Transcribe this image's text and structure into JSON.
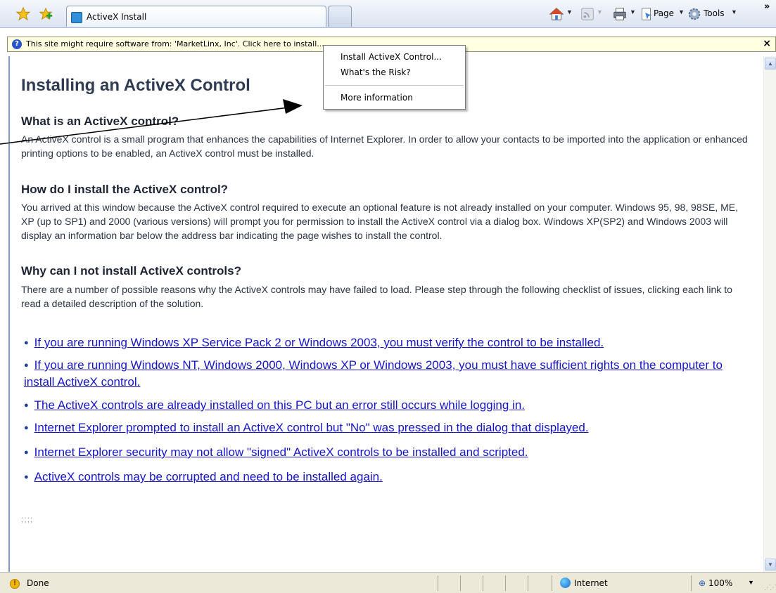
{
  "toolbar": {
    "tab_title": "ActiveX Install",
    "page_label": "Page",
    "tools_label": "Tools",
    "overflow_label": "»"
  },
  "infobar": {
    "text": "This site might require software from: 'MarketLinx, Inc'. Click here to install...",
    "close_label": "×"
  },
  "context_menu": {
    "items": [
      "Install ActiveX Control...",
      "What's the Risk?",
      "More information"
    ]
  },
  "page": {
    "heading": "Installing an ActiveX Control",
    "sections": [
      {
        "heading": "What is an ActiveX control?",
        "body": "An ActiveX control is a small program that enhances the capabilities of Internet Explorer. In order to allow your contacts to be imported into the application or enhanced printing options to be enabled, an ActiveX control must be installed."
      },
      {
        "heading": "How do I install the ActiveX control?",
        "body": "You arrived at this window because the ActiveX control required to execute an optional feature is not already installed on your computer. Windows 95, 98, 98SE, ME, XP (up to SP1) and 2000 (various versions) will prompt you for permission to install the ActiveX control via a dialog box. Windows XP(SP2) and Windows 2003 will display an information bar below the address bar indicating the page wishes to install the control."
      },
      {
        "heading": "Why can I not install ActiveX controls?",
        "body": "There are a number of possible reasons why the ActiveX controls may have failed to load. Please step through the following checklist of issues, clicking each link to read a detailed description of the solution."
      }
    ],
    "links": [
      "If you are running Windows XP Service Pack 2 or Windows 2003, you must verify the control to be installed.",
      "If you are running Windows NT, Windows 2000, Windows XP or Windows 2003, you must have sufficient rights on the computer to install ActiveX control.",
      "The ActiveX controls are already installed on this PC but an error still occurs while logging in.",
      "Internet Explorer prompted to install an ActiveX control but \"No\" was pressed in the dialog that displayed.",
      "Internet Explorer security may not allow \"signed\" ActiveX controls to be installed and scripted.",
      "ActiveX controls may be corrupted and need to be installed again."
    ],
    "trailing_dots": ";;;;"
  },
  "statusbar": {
    "status": "Done",
    "zone": "Internet",
    "zoom": "100%"
  },
  "colors": {
    "link": "#1515c8",
    "heading": "#2f3b52",
    "infobar_bg": "#ffffe1"
  },
  "icons": [
    "favorites-star-icon",
    "add-favorites-icon",
    "home-icon",
    "feeds-icon",
    "print-icon",
    "page-icon",
    "tools-gear-icon",
    "info-icon",
    "warning-icon",
    "globe-icon",
    "zoom-icon"
  ]
}
